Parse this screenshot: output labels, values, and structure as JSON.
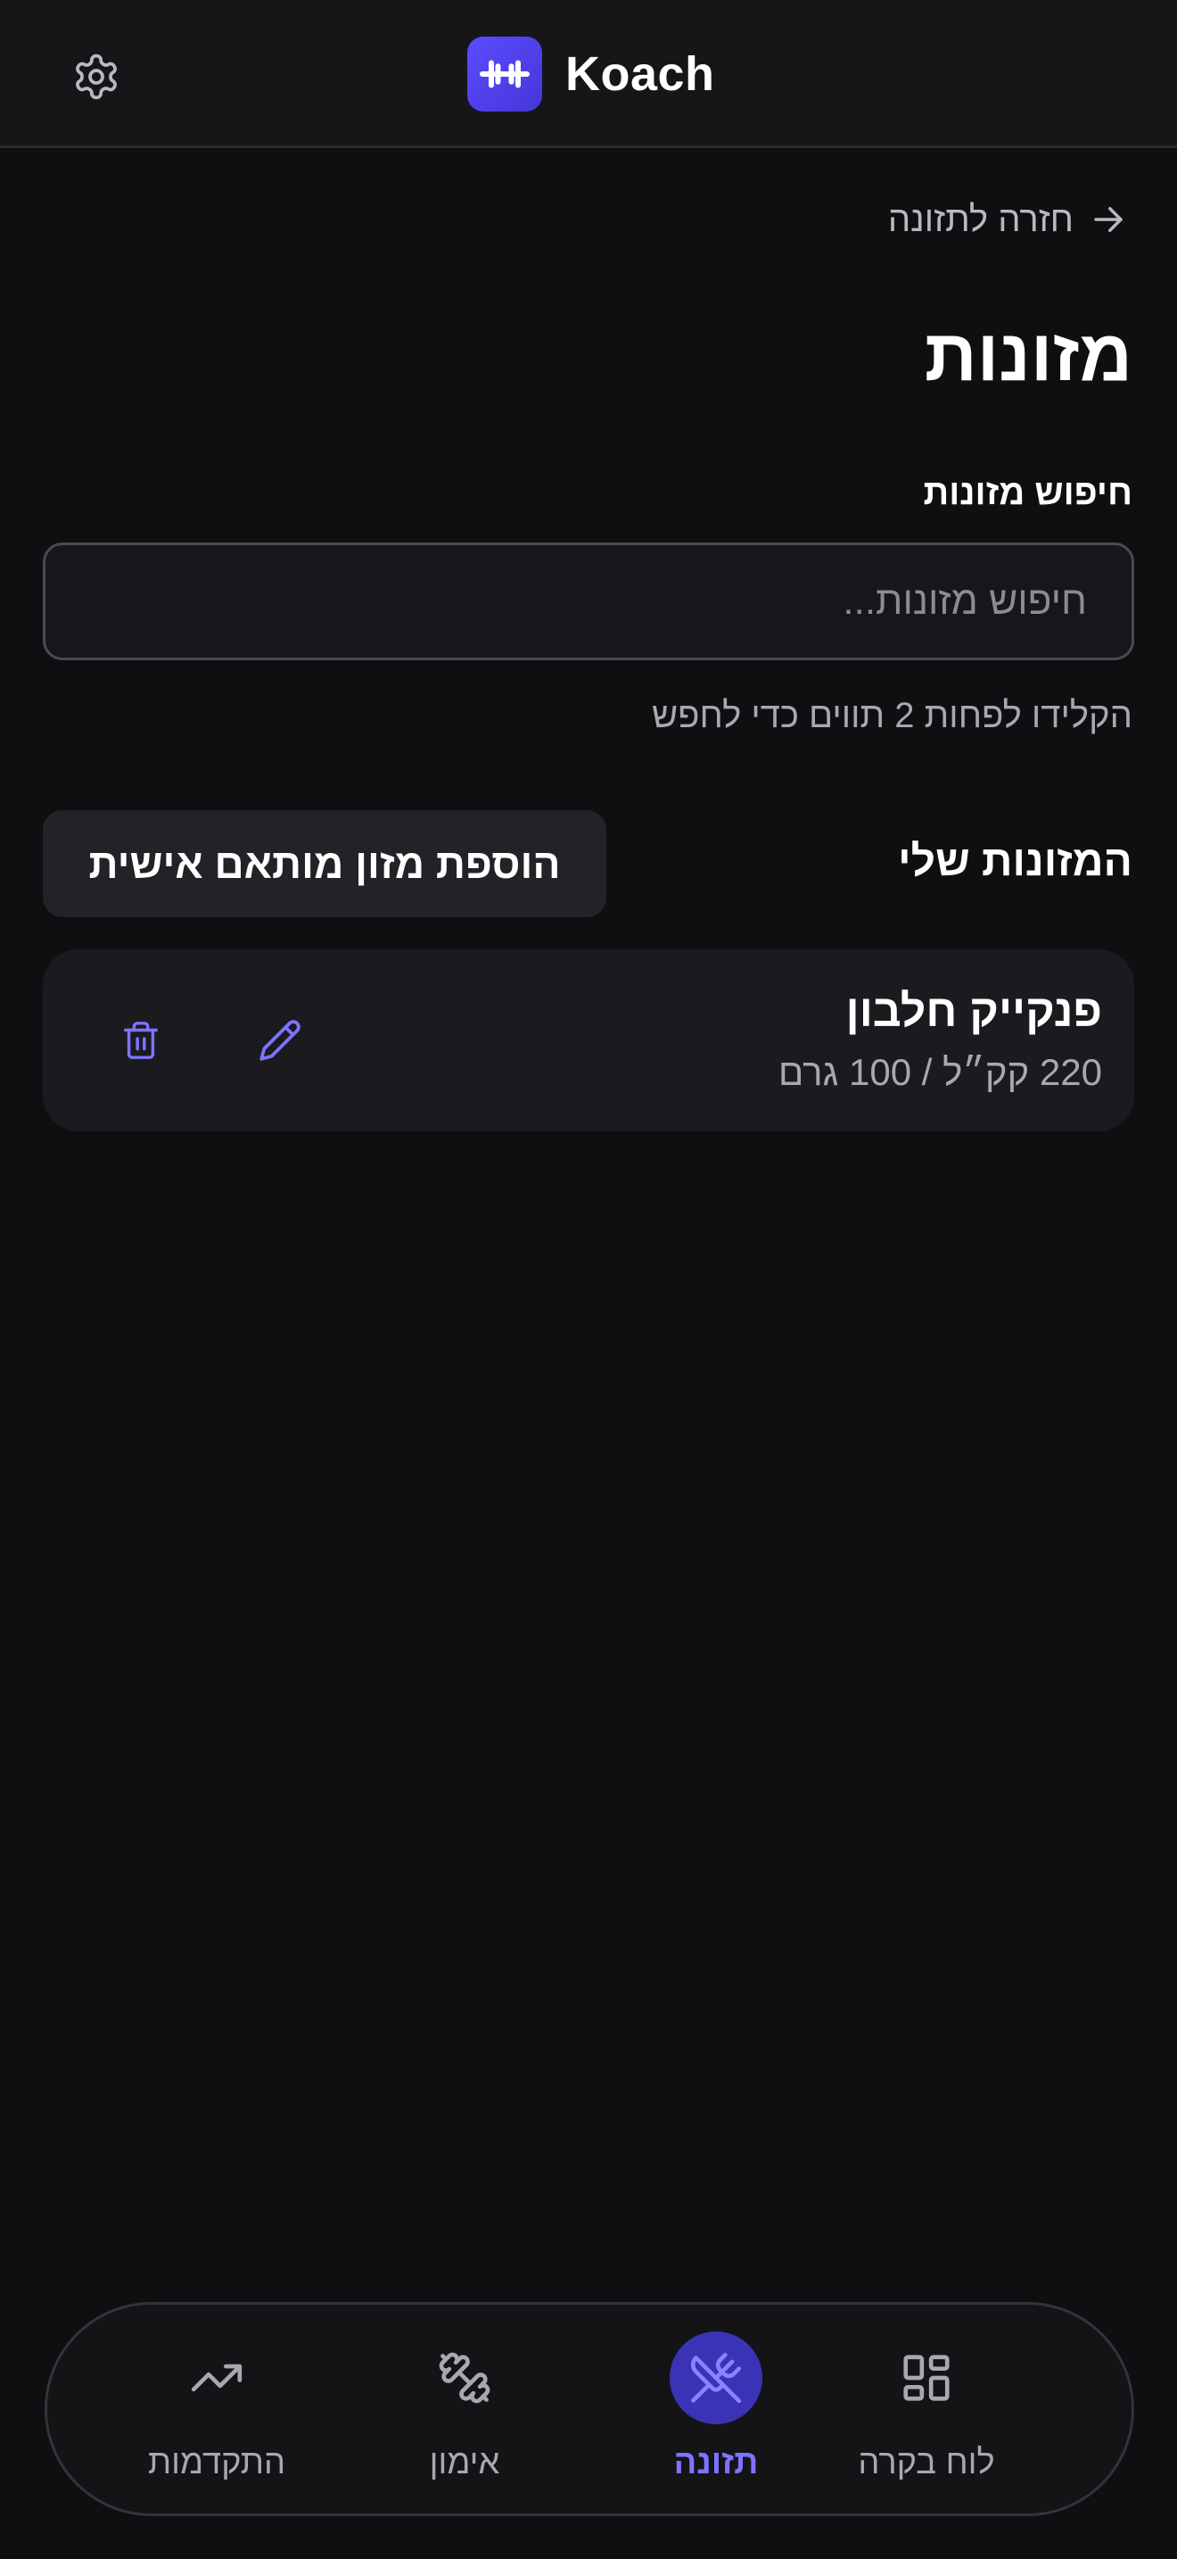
{
  "header": {
    "brand_name": "Koach",
    "settings_icon": "gear-icon",
    "logo_icon": "dumbbell-icon"
  },
  "back_link": {
    "label": "חזרה לתזונה",
    "icon": "arrow-right-icon"
  },
  "page_title": "מזונות",
  "search": {
    "label": "חיפוש מזונות",
    "placeholder": "חיפוש מזונות...",
    "value": "",
    "hint": "הקלידו לפחות 2 תווים כדי לחפש"
  },
  "my_foods": {
    "title": "המזונות שלי",
    "add_button_label": "הוספת מזון מותאם אישית",
    "items": [
      {
        "name": "פנקייק חלבון",
        "meta": "220 קק״ל / 100 גרם"
      }
    ]
  },
  "bottom_nav": {
    "items": [
      {
        "label": "לוח בקרה",
        "icon": "dashboard-grid-icon",
        "active": false
      },
      {
        "label": "תזונה",
        "icon": "fork-knife-icon",
        "active": true
      },
      {
        "label": "אימון",
        "icon": "dumbbell-icon",
        "active": false
      },
      {
        "label": "התקדמות",
        "icon": "trending-up-icon",
        "active": false
      }
    ]
  },
  "colors": {
    "background": "#0f0f11",
    "accent": "#5b4bff",
    "accent_text": "#7d74ff",
    "card": "#1b1b1f"
  }
}
